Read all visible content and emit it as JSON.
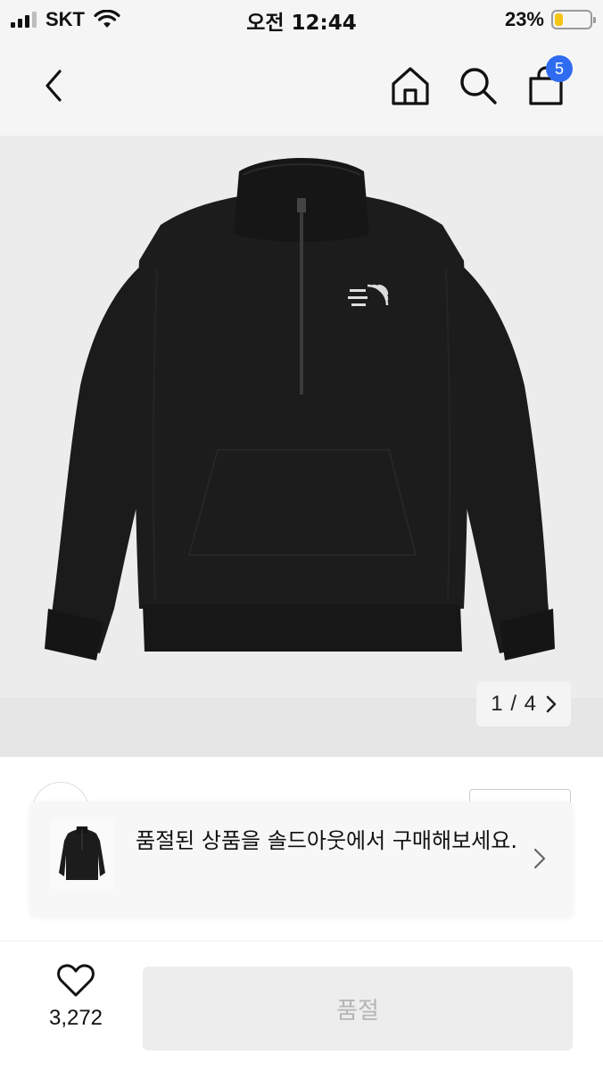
{
  "status_bar": {
    "carrier": "SKT",
    "time": "오전 12:44",
    "battery_percent": "23%",
    "battery_level": 0.23,
    "battery_color": "#f5c518",
    "signal_bars_active": 3
  },
  "nav": {
    "back_icon": "chevron-left-icon",
    "home_icon": "home-icon",
    "search_icon": "search-icon",
    "cart_icon": "shopping-bag-icon",
    "cart_count": "5",
    "badge_color": "#2f6bf0"
  },
  "product_image": {
    "pager_current": "1",
    "pager_total": "4",
    "pager_text": "1 / 4",
    "brand_logo_text": "THE NORTH FACE"
  },
  "toast": {
    "message": "품절된 상품을 솔드아웃에서 구매해보세요."
  },
  "bottom_bar": {
    "like_count": "3,272",
    "soldout_label": "품절"
  }
}
